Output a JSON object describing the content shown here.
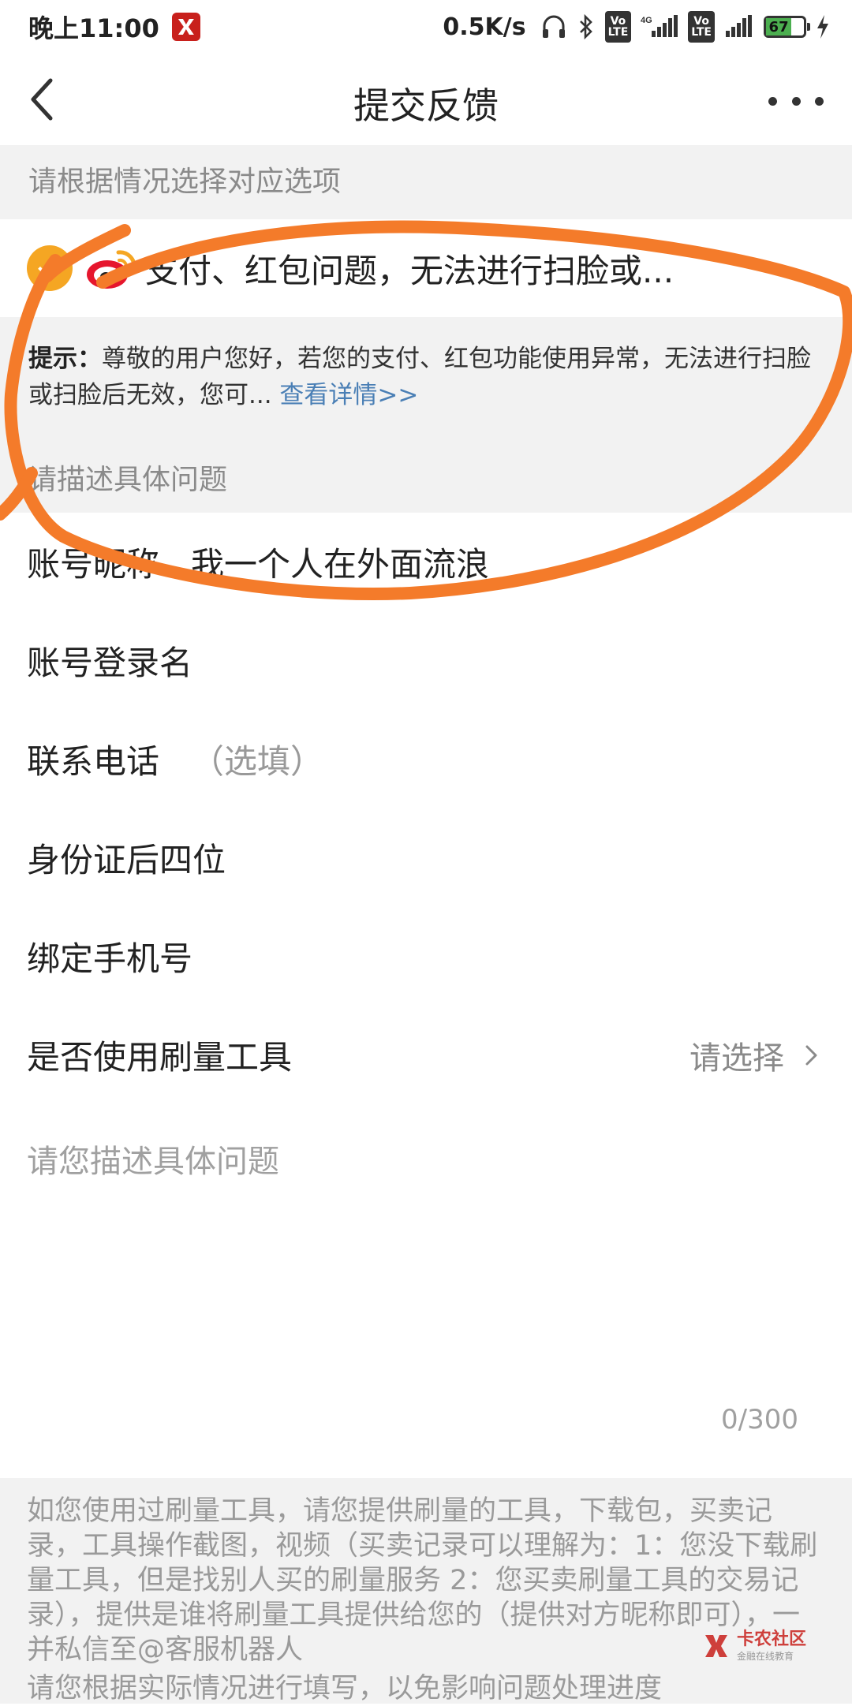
{
  "status_bar": {
    "time": "晚上11:00",
    "net_speed": "0.5K/s",
    "network1": "VoLTE",
    "network2": "4G",
    "battery": "67"
  },
  "header": {
    "title": "提交反馈"
  },
  "section1": {
    "title": "请根据情况选择对应选项"
  },
  "option": {
    "label": "支付、红包问题，无法进行扫脸或..."
  },
  "hint": {
    "prefix": "提示：",
    "text": "尊敬的用户您好，若您的支付、红包功能使用异常，无法进行扫脸或扫脸后无效，您可...",
    "link": "查看详情>>"
  },
  "section2": {
    "title": "请描述具体问题"
  },
  "fields": [
    {
      "label": "账号昵称",
      "value": "我一个人在外面流浪"
    },
    {
      "label": "账号登录名"
    },
    {
      "label": "联系电话",
      "optional": "（选填）"
    },
    {
      "label": "身份证后四位"
    },
    {
      "label": "绑定手机号"
    },
    {
      "label": "是否使用刷量工具",
      "select": "请选择"
    }
  ],
  "description": {
    "placeholder": "请您描述具体问题",
    "count": "0/300"
  },
  "footer": {
    "note": "如您使用过刷量工具，请您提供刷量的工具，下载包，买卖记录，工具操作截图，视频（买卖记录可以理解为：1：您没下载刷量工具，但是找别人买的刷量服务 2：您买卖刷量工具的交易记录），提供是谁将刷量工具提供给您的（提供对方昵称即可），一并私信至@客服机器人",
    "note2": "请您根据实际情况进行填写，以免影响问题处理进度"
  },
  "watermark": {
    "title": "卡农社区",
    "subtitle": "金融在线教育"
  },
  "colors": {
    "accent_orange": "#f5a623",
    "scribble_orange": "#f47b2a",
    "link_blue": "#4a7fb5",
    "section_bg": "#f2f2f2"
  }
}
